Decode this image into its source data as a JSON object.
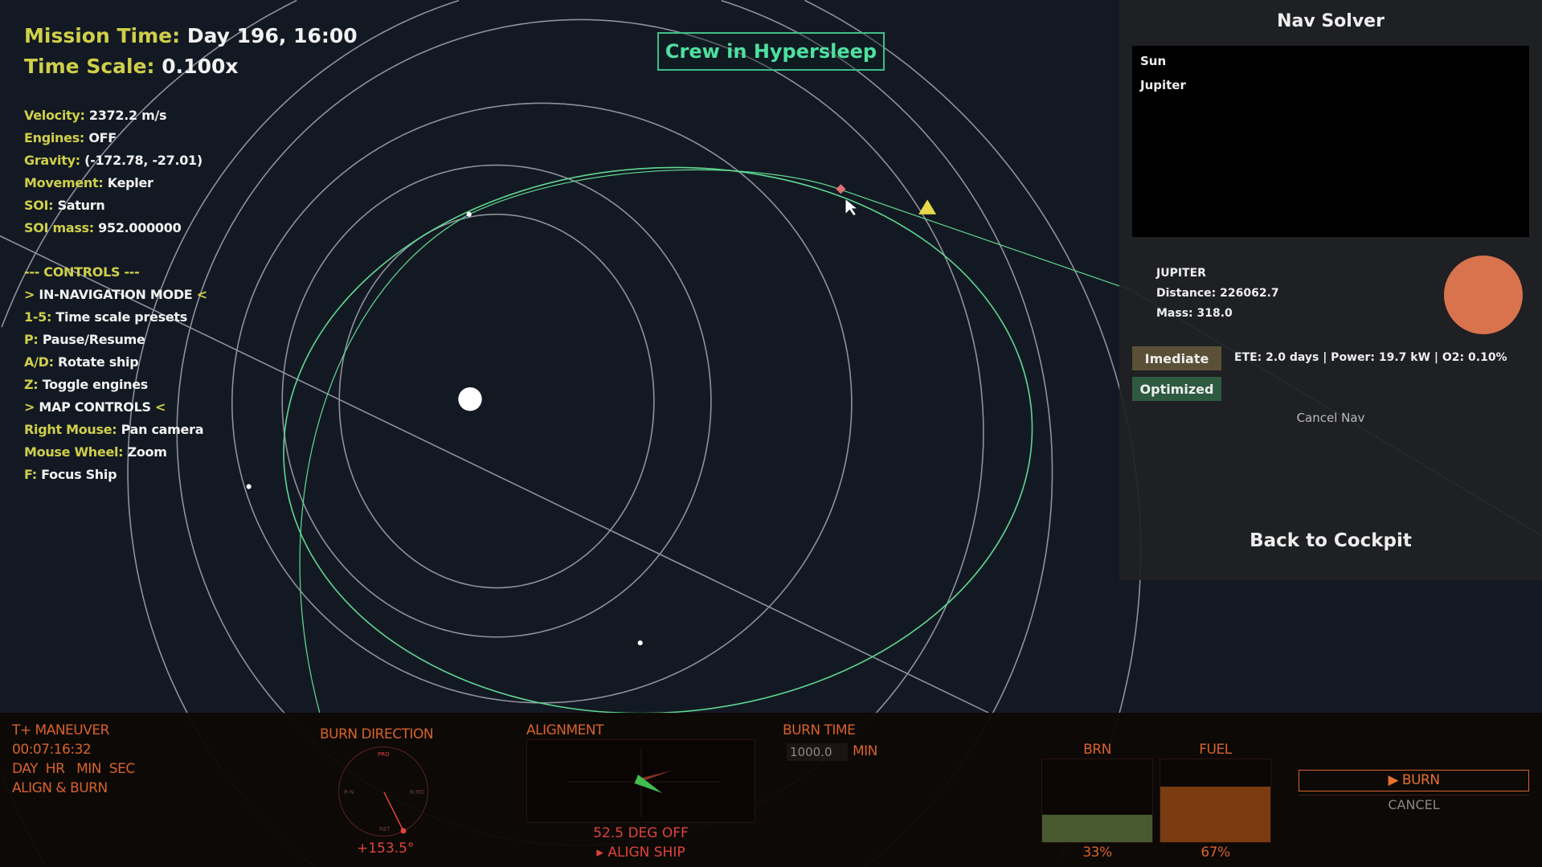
{
  "hud": {
    "mission_time_label": "Mission Time:",
    "mission_time": "Day 196, 16:00",
    "time_scale_label": "Time Scale:",
    "time_scale": "0.100x",
    "stats": [
      {
        "label": "Velocity:",
        "value": "2372.2 m/s"
      },
      {
        "label": "Engines:",
        "value": "OFF"
      },
      {
        "label": "Gravity:",
        "value": "(-172.78, -27.01)"
      },
      {
        "label": "Movement:",
        "value": "Kepler"
      },
      {
        "label": "SOI:",
        "value": "Saturn"
      },
      {
        "label": "SOI mass:",
        "value": "952.000000"
      }
    ],
    "controls_header": "--- CONTROLS ---",
    "controls": [
      {
        "label": ">",
        "value": "IN-NAVIGATION MODE",
        "end": "<"
      },
      {
        "label": "1-5:",
        "value": "Time scale presets"
      },
      {
        "label": "P:",
        "value": "Pause/Resume"
      },
      {
        "label": "A/D:",
        "value": "Rotate ship"
      },
      {
        "label": "Z:",
        "value": "Toggle engines"
      },
      {
        "label": ">",
        "value": "MAP CONTROLS",
        "end": "<"
      },
      {
        "label": "Right Mouse:",
        "value": "Pan camera"
      },
      {
        "label": "Mouse Wheel:",
        "value": "Zoom"
      },
      {
        "label": "F:",
        "value": "Focus Ship"
      }
    ]
  },
  "status_banner": "Crew in Hypersleep",
  "nav_solver": {
    "title": "Nav Solver",
    "targets": [
      "Sun",
      "Jupiter"
    ],
    "selected": {
      "name": "JUPITER",
      "distance": "Distance: 226062.7",
      "mass": "Mass: 318.0",
      "color": "#d9734e"
    },
    "immediate_label": "Imediate",
    "optimized_label": "Optimized",
    "route_info": "ETE: 2.0 days | Power: 19.7 kW | O2: 0.10%",
    "cancel_label": "Cancel Nav",
    "back_label": "Back to Cockpit"
  },
  "maneuver": {
    "title": "T+ MANEUVER",
    "countdown": "00:07:16:32",
    "units": "DAY  HR   MIN  SEC",
    "mode": "ALIGN & BURN",
    "burn_direction_label": "BURN DIRECTION",
    "compass": {
      "top": "PRO",
      "left": "R-N",
      "right": "N-RD",
      "bottom": "RET"
    },
    "burn_direction_value": "+153.5°",
    "alignment_label": "ALIGNMENT",
    "alignment_off": "52.5 DEG OFF",
    "align_ship": "▸ ALIGN SHIP",
    "burn_time_label": "BURN TIME",
    "burn_time_value": "1000.0",
    "burn_time_unit": "MIN",
    "brn_label": "BRN",
    "brn_percent": "33%",
    "brn_fraction": 0.33,
    "fuel_label": "FUEL",
    "fuel_percent": "67%",
    "fuel_fraction": 0.67,
    "burn_button": "▶ BURN",
    "cancel_button": "CANCEL"
  }
}
